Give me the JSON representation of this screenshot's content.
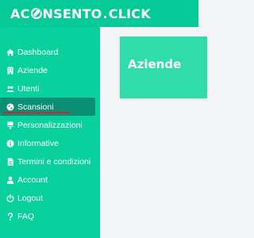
{
  "logo": {
    "part1": "AC",
    "part2": "NSENTO",
    "dot": ".",
    "part3": "CLICK"
  },
  "colors": {
    "topbar": "#05c997",
    "sidebar": "#08d19d",
    "active": "#0a8f74",
    "card": "#30dca9",
    "underline": "#d8232a"
  },
  "sidebar": {
    "items": [
      {
        "label": "Dashboard",
        "icon": "home-icon"
      },
      {
        "label": "Aziende",
        "icon": "building-icon"
      },
      {
        "label": "Utenti",
        "icon": "users-icon"
      },
      {
        "label": "Scansioni",
        "icon": "globe-icon",
        "active": true
      },
      {
        "label": "Personalizzazioni",
        "icon": "brush-icon"
      },
      {
        "label": "Informative",
        "icon": "info-icon"
      },
      {
        "label": "Termini e condizioni",
        "icon": "document-icon"
      },
      {
        "label": "Account",
        "icon": "user-icon"
      },
      {
        "label": "Logout",
        "icon": "power-icon"
      },
      {
        "label": "FAQ",
        "icon": "question-icon"
      }
    ]
  },
  "main": {
    "card_title": "Aziende"
  }
}
